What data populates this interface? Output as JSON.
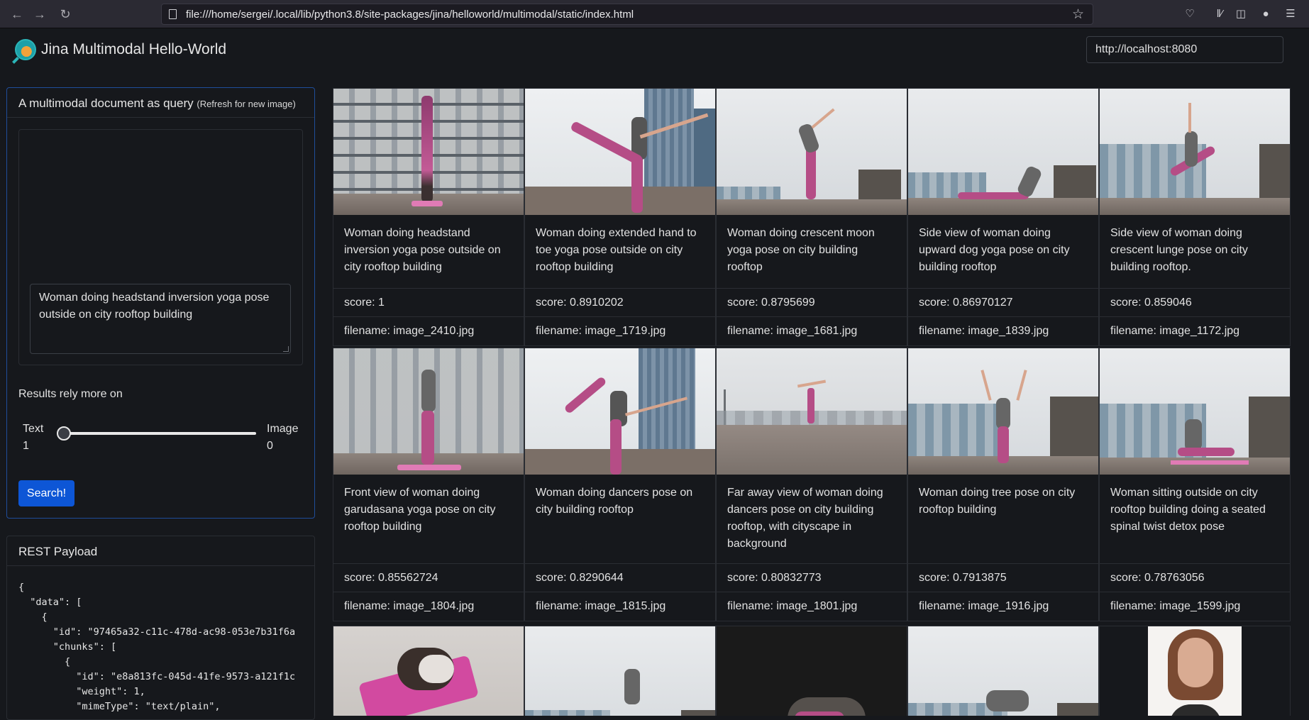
{
  "browser": {
    "url": "file:///home/sergei/.local/lib/python3.8/site-packages/jina/helloworld/multimodal/static/index.html"
  },
  "header": {
    "brand": "Jina Multimodal Hello-World",
    "endpoint": "http://localhost:8080"
  },
  "query": {
    "title": "A multimodal document as query",
    "title_note": "(Refresh for new image)",
    "text": "Woman doing headstand inversion yoga pose outside on city rooftop building",
    "rely_label": "Results rely more on",
    "text_label": "Text",
    "text_value": "1",
    "image_label": "Image",
    "image_value": "0",
    "weight_text_fraction": 1,
    "search_label": "Search!"
  },
  "rest": {
    "title": "REST Payload",
    "payload": "{\n  \"data\": [\n    {\n      \"id\": \"97465a32-c11c-478d-ac98-053e7b31f6a\n      \"chunks\": [\n        {\n          \"id\": \"e8a813fc-045d-41fe-9573-a121f1c\n          \"weight\": 1,\n          \"mimeType\": \"text/plain\","
  },
  "results": [
    {
      "caption": "Woman doing headstand inversion yoga pose outside on city rooftop building",
      "score": "score: 1",
      "filename": "filename: image_2410.jpg"
    },
    {
      "caption": "Woman doing extended hand to toe yoga pose outside on city rooftop building",
      "score": "score: 0.8910202",
      "filename": "filename: image_1719.jpg"
    },
    {
      "caption": "Woman doing crescent moon yoga pose on city building rooftop",
      "score": "score: 0.8795699",
      "filename": "filename: image_1681.jpg"
    },
    {
      "caption": "Side view of woman doing upward dog yoga pose on city building rooftop",
      "score": "score: 0.86970127",
      "filename": "filename: image_1839.jpg"
    },
    {
      "caption": "Side view of woman doing crescent lunge pose on city building rooftop.",
      "score": "score: 0.859046",
      "filename": "filename: image_1172.jpg"
    },
    {
      "caption": "Front view of woman doing garudasana yoga pose on city rooftop building",
      "score": "score: 0.85562724",
      "filename": "filename: image_1804.jpg"
    },
    {
      "caption": "Woman doing dancers pose on city building rooftop",
      "score": "score: 0.8290644",
      "filename": "filename: image_1815.jpg"
    },
    {
      "caption": "Far away view of woman doing dancers pose on city building rooftop, with cityscape in background",
      "score": "score: 0.80832773",
      "filename": "filename: image_1801.jpg"
    },
    {
      "caption": "Woman doing tree pose on city rooftop building",
      "score": "score: 0.7913875",
      "filename": "filename: image_1916.jpg"
    },
    {
      "caption": "Woman sitting outside on city rooftop building doing a seated spinal twist detox pose",
      "score": "score: 0.78763056",
      "filename": "filename: image_1599.jpg"
    }
  ],
  "icons": {
    "back": "arrow-left-icon",
    "forward": "arrow-right-icon",
    "reload": "reload-icon",
    "bookmark": "star-icon",
    "pocket": "pocket-icon",
    "library": "library-icon",
    "sidebar": "sidebar-icon",
    "account": "mask-icon",
    "menu": "hamburger-menu-icon"
  },
  "colors": {
    "background": "#16181c",
    "accent": "#0d56d6",
    "query_border": "#1f4d9a"
  }
}
